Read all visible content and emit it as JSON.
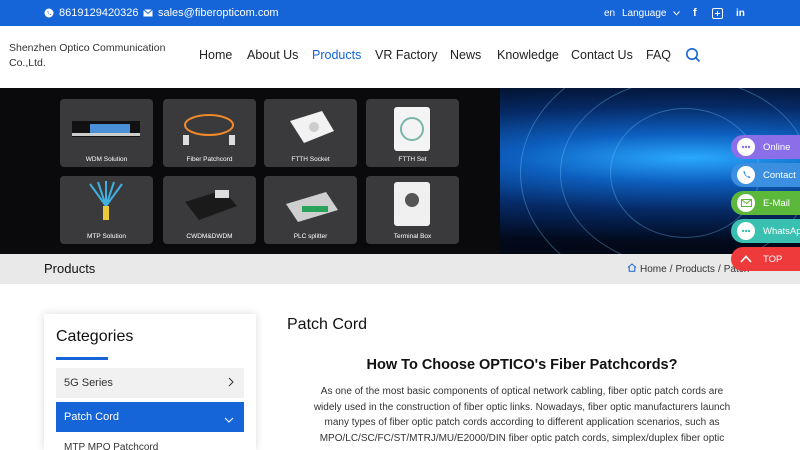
{
  "topbar": {
    "phone": "8619129420326",
    "email": "sales@fiberopticom.com",
    "lang_code": "en",
    "language_label": "Language",
    "social": [
      "f",
      "in"
    ]
  },
  "header": {
    "brand": "Shenzhen Optico Communication Co.,Ltd.",
    "nav": [
      "Home",
      "About Us",
      "Products",
      "VR Factory",
      "News",
      "Knowledge",
      "Contact Us",
      "FAQ"
    ],
    "active_nav": "Products"
  },
  "banner": {
    "tiles": [
      "WDM Solution",
      "Fiber Patchcord",
      "FTTH Socket",
      "FTTH Set",
      "MTP Solution",
      "CWDM&DWDM",
      "PLC splitter",
      "Terminal Box"
    ]
  },
  "breadcrumb": {
    "page_title": "Products",
    "home": "Home",
    "sep": "/",
    "products": "Products",
    "current": "Patch"
  },
  "sidebar": {
    "heading": "Categories",
    "categories": [
      "5G Series",
      "Patch Cord"
    ],
    "sub_item": "MTP MPO Patchcord"
  },
  "main": {
    "title": "Patch Cord",
    "heading": "How To Choose OPTICO's Fiber Patchcords?",
    "paragraph": "As one of the most basic components of optical network cabling, fiber optic patch cords are widely used in the construction of fiber optic links. Nowadays, fiber optic manufacturers launch many types of fiber optic patch cords according to different application scenarios, such as MPO/LC/SC/FC/ST/MTRJ/MU/E2000/DIN fiber optic patch cords, simplex/duplex fiber optic"
  },
  "float_buttons": [
    {
      "label": "Online",
      "color": "#8a6fe8"
    },
    {
      "label": "Contact",
      "color": "#3a8fe0"
    },
    {
      "label": "E-Mail",
      "color": "#5cb83a"
    },
    {
      "label": "WhatsApp",
      "color": "#39c0b0"
    },
    {
      "label": "TOP",
      "color": "#ee3a3a"
    }
  ],
  "colors": {
    "brand_blue": "#1565d8"
  }
}
